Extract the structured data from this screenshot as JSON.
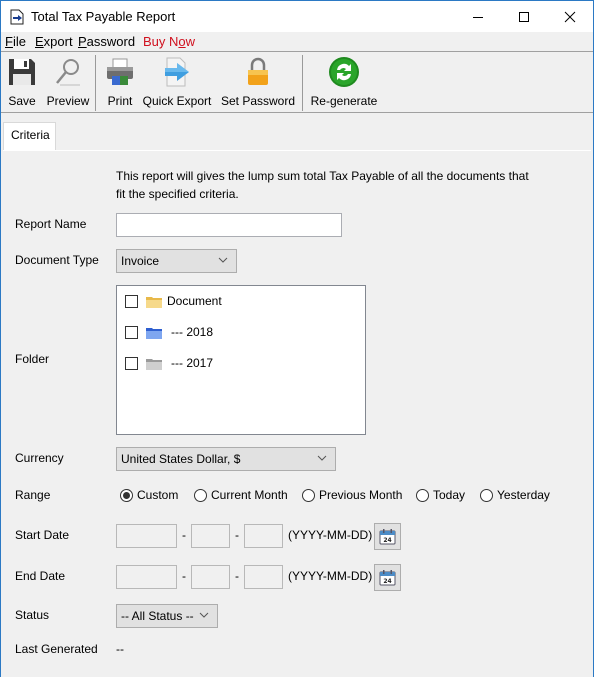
{
  "window": {
    "title": "Total Tax Payable Report",
    "controls": {
      "minimize": "minimize",
      "maximize": "maximize",
      "close": "close"
    }
  },
  "menu": [
    {
      "label": "File",
      "mnemonic": "F",
      "rest": "ile"
    },
    {
      "label": "Export",
      "mnemonic": "E",
      "rest": "xport"
    },
    {
      "label": "Password",
      "mnemonic": "P",
      "rest": "assword"
    },
    {
      "label": "Buy Now",
      "pre": "Buy N",
      "mnemonic": "o",
      "rest": "w",
      "color": "#d0101e"
    }
  ],
  "toolbar": {
    "save": "Save",
    "preview": "Preview",
    "print": "Print",
    "quick_export": "Quick Export",
    "set_password": "Set Password",
    "regenerate": "Re-generate"
  },
  "tabs": [
    {
      "label": "Criteria",
      "active": true
    }
  ],
  "form": {
    "description": "This report will gives the lump sum total Tax Payable of all the documents that fit the specified criteria.",
    "report_name": {
      "label": "Report Name",
      "value": ""
    },
    "document_type": {
      "label": "Document Type",
      "value": "Invoice"
    },
    "folder": {
      "label": "Folder",
      "items": [
        {
          "label": "Document",
          "icon": "folder-yellow-icon",
          "checked": false
        },
        {
          "label": "--- 2018",
          "icon": "folder-blue-icon",
          "checked": false
        },
        {
          "label": "--- 2017",
          "icon": "folder-gray-icon",
          "checked": false
        }
      ]
    },
    "currency": {
      "label": "Currency",
      "value": "United States Dollar, $"
    },
    "range": {
      "label": "Range",
      "options": [
        "Custom",
        "Current Month",
        "Previous Month",
        "Today",
        "Yesterday"
      ],
      "selected": "Custom"
    },
    "start_date": {
      "label": "Start Date",
      "year": "",
      "month": "",
      "day": "",
      "separator": "-",
      "format": "(YYYY-MM-DD)"
    },
    "end_date": {
      "label": "End Date",
      "year": "",
      "month": "",
      "day": "",
      "separator": "-",
      "format": "(YYYY-MM-DD)"
    },
    "status": {
      "label": "Status",
      "value": "-- All Status --"
    },
    "last_generated": {
      "label": "Last Generated",
      "value": "--"
    },
    "calendar_day": "24"
  }
}
